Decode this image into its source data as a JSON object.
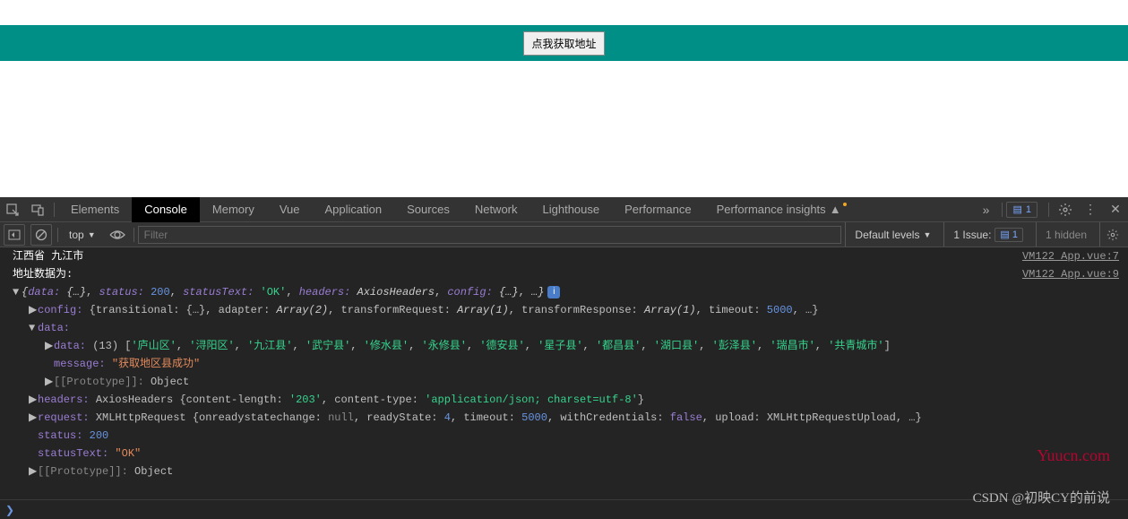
{
  "page": {
    "button_label": "点我获取地址"
  },
  "devtools": {
    "tabs": [
      "Elements",
      "Console",
      "Memory",
      "Vue",
      "Application",
      "Sources",
      "Network",
      "Lighthouse",
      "Performance",
      "Performance insights"
    ],
    "active_tab": "Console",
    "badge_count": "1",
    "toolbar": {
      "context": "top",
      "filter_placeholder": "Filter",
      "levels": "Default levels",
      "issue_label": "1 Issue:",
      "issue_count": "1",
      "hidden": "1 hidden"
    }
  },
  "console": {
    "line1": {
      "text": "江西省 九江市",
      "src": "VM122 App.vue:7"
    },
    "line2": {
      "text": "地址数据为:",
      "src": "VM122 App.vue:9"
    },
    "obj_summary": {
      "data_k": "data:",
      "data_v": "{…}",
      "status_k": "status:",
      "status_v": "200",
      "statusText_k": "statusText:",
      "statusText_v": "'OK'",
      "headers_k": "headers:",
      "headers_v": "AxiosHeaders",
      "config_k": "config:",
      "config_v": "{…}",
      "rest": "…"
    },
    "config": {
      "k": "config:",
      "trans_k": "transitional:",
      "trans_v": "{…}",
      "adapter_k": "adapter:",
      "adapter_v": "Array(2)",
      "treq_k": "transformRequest:",
      "treq_v": "Array(1)",
      "tres_k": "transformResponse:",
      "tres_v": "Array(1)",
      "timeout_k": "timeout:",
      "timeout_v": "5000",
      "rest": "…"
    },
    "data": {
      "k": "data:",
      "inner_k": "data:",
      "count": "(13)",
      "items": [
        "'庐山区'",
        "'浔阳区'",
        "'九江县'",
        "'武宁县'",
        "'修水县'",
        "'永修县'",
        "'德安县'",
        "'星子县'",
        "'都昌县'",
        "'湖口县'",
        "'彭泽县'",
        "'瑞昌市'",
        "'共青城市'"
      ],
      "message_k": "message:",
      "message_v": "\"获取地区县成功\"",
      "proto_k": "[[Prototype]]:",
      "proto_v": "Object"
    },
    "headers": {
      "k": "headers:",
      "cls": "AxiosHeaders",
      "cl_k": "content-length:",
      "cl_v": "'203'",
      "ct_k": "content-type:",
      "ct_v": "'application/json; charset=utf-8'"
    },
    "request": {
      "k": "request:",
      "cls": "XMLHttpRequest",
      "or_k": "onreadystatechange:",
      "or_v": "null",
      "rs_k": "readyState:",
      "rs_v": "4",
      "to_k": "timeout:",
      "to_v": "5000",
      "wc_k": "withCredentials:",
      "wc_v": "false",
      "up_k": "upload:",
      "up_v": "XMLHttpRequestUpload",
      "rest": "…"
    },
    "status": {
      "k": "status:",
      "v": "200"
    },
    "statusText": {
      "k": "statusText:",
      "v": "\"OK\""
    },
    "proto": {
      "k": "[[Prototype]]:",
      "v": "Object"
    }
  },
  "watermark": {
    "top": "Yuucn.com",
    "bottom": "CSDN @初映CY的前说"
  }
}
